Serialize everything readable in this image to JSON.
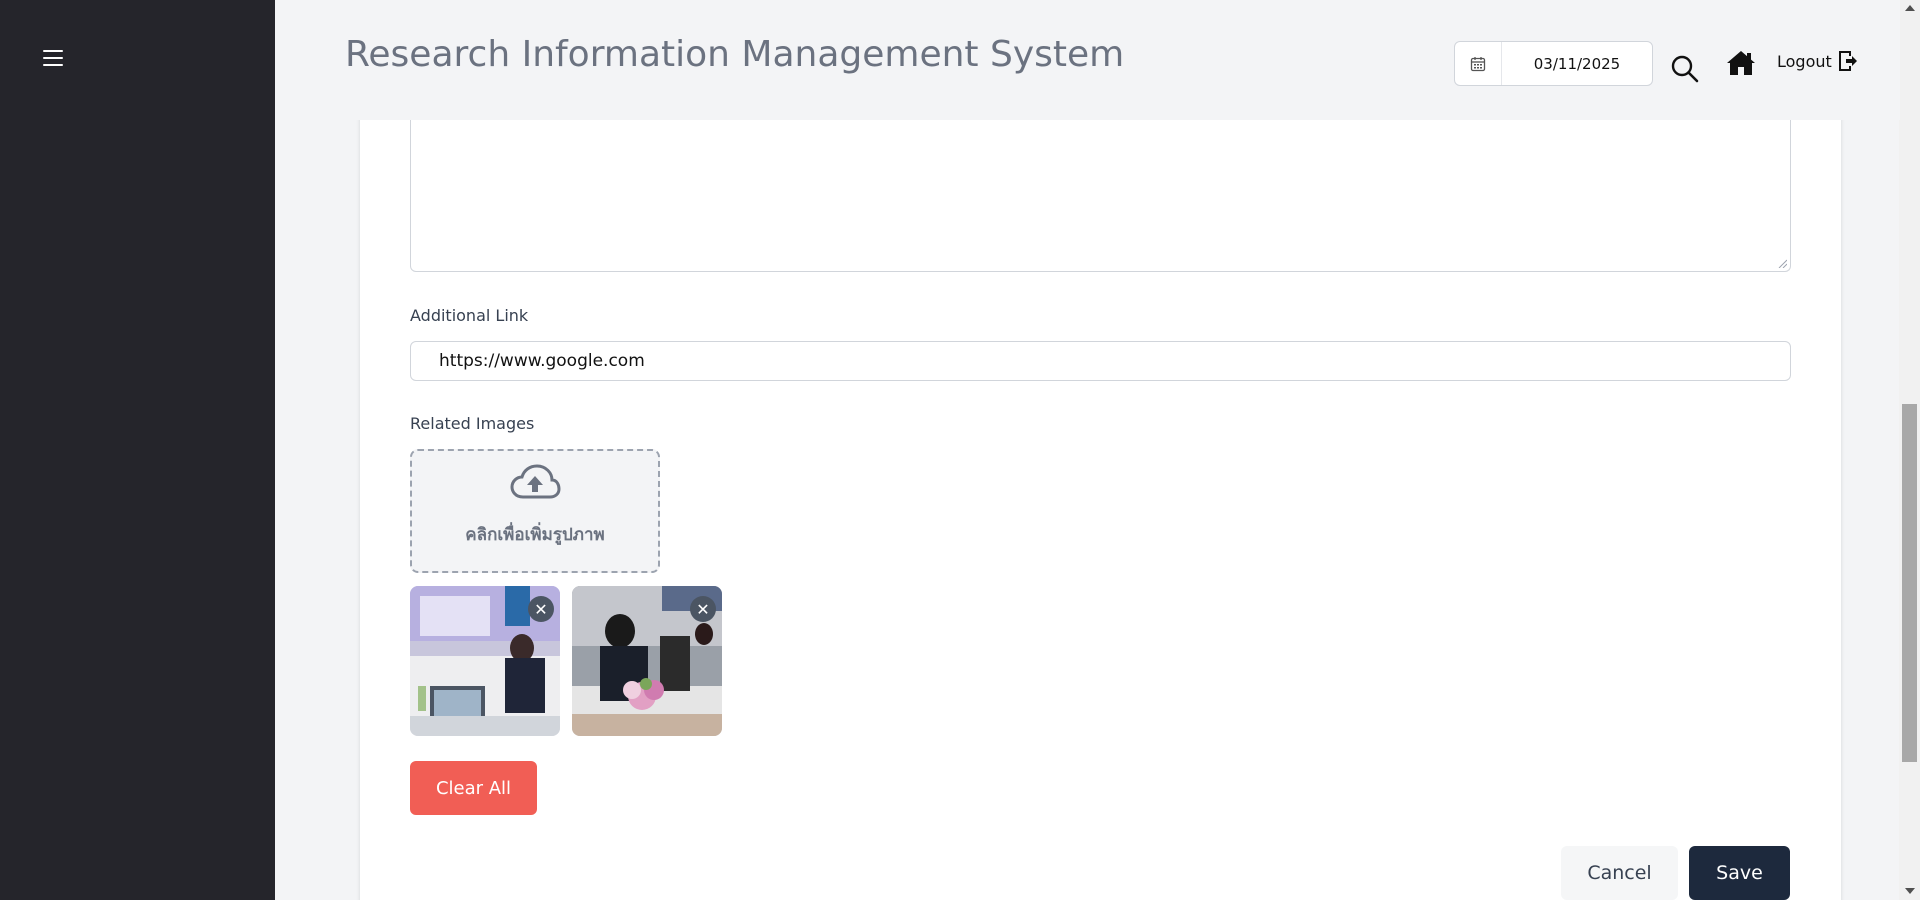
{
  "header": {
    "title": "Research Information Management System",
    "date": "03/11/2025",
    "logout_label": "Logout"
  },
  "form": {
    "additional_link_label": "Additional Link",
    "additional_link_value": "https://www.google.com",
    "related_images_label": "Related Images",
    "upload_text": "คลิกเพื่อเพิ่มรูปภาพ",
    "images": [
      {
        "alt": "photo-1",
        "remove_glyph": "✕"
      },
      {
        "alt": "photo-2",
        "remove_glyph": "✕"
      }
    ],
    "clear_all_label": "Clear All",
    "cancel_label": "Cancel",
    "save_label": "Save"
  },
  "icons": {
    "menu": "hamburger-menu-icon",
    "calendar": "calendar-icon",
    "search": "search-icon",
    "home": "home-icon",
    "logout": "logout-icon",
    "upload": "cloud-upload-icon",
    "remove": "close-icon"
  },
  "colors": {
    "sidebar": "#25252b",
    "clear_button": "#f15e55",
    "save_button": "#1d293d"
  }
}
